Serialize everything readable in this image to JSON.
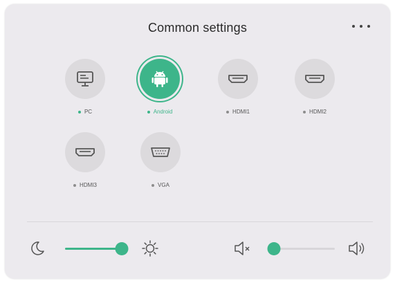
{
  "header": {
    "title": "Common settings"
  },
  "sources": [
    {
      "label": "PC",
      "icon": "monitor-icon",
      "active": false,
      "connected": true
    },
    {
      "label": "Android",
      "icon": "android-icon",
      "active": true,
      "connected": true
    },
    {
      "label": "HDMI1",
      "icon": "hdmi-port-icon",
      "active": false,
      "connected": false
    },
    {
      "label": "HDMI2",
      "icon": "hdmi-port-icon",
      "active": false,
      "connected": false
    },
    {
      "label": "HDMI3",
      "icon": "hdmi-port-icon",
      "active": false,
      "connected": false
    },
    {
      "label": "VGA",
      "icon": "vga-port-icon",
      "active": false,
      "connected": false
    }
  ],
  "controls": {
    "brightness": {
      "value": 1.0,
      "min_icon": "moon-icon",
      "max_icon": "sun-icon"
    },
    "volume": {
      "value": 0.0,
      "min_icon": "speaker-mute-icon",
      "max_icon": "speaker-loud-icon"
    }
  },
  "colors": {
    "accent": "#3db58a",
    "panel": "#eceaee",
    "icon_circle": "#dcdadd"
  }
}
